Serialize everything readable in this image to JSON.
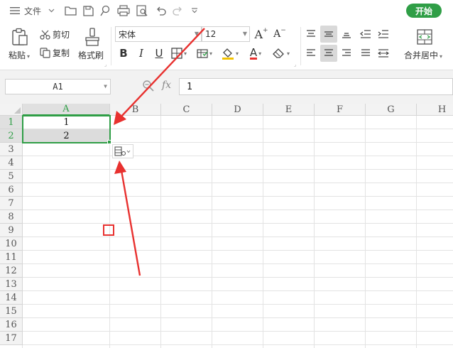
{
  "menubar": {
    "file_label": "文件",
    "start_tab": "开始"
  },
  "ribbon": {
    "paste_label": "粘贴",
    "cut_label": "剪切",
    "copy_label": "复制",
    "format_painter_label": "格式刷",
    "font_name": "宋体",
    "font_size": "12",
    "bold": "B",
    "italic": "I",
    "underline": "U",
    "font_color_glyph": "A",
    "merge_center_label": "合并居中"
  },
  "formula_bar": {
    "name_box": "A1",
    "fx": "fx",
    "formula_value": "1"
  },
  "sheet": {
    "columns": [
      "A",
      "B",
      "C",
      "D",
      "E",
      "F",
      "G",
      "H"
    ],
    "rows": [
      "1",
      "2",
      "3",
      "4",
      "5",
      "6",
      "7",
      "8",
      "9",
      "10",
      "11",
      "12",
      "13",
      "14",
      "15",
      "16",
      "17"
    ],
    "cells": {
      "A1": "1",
      "A2": "2"
    },
    "selection": "A1:A2"
  },
  "colors": {
    "accent_green": "#2f9e46",
    "annotation_red": "#e8312f"
  }
}
